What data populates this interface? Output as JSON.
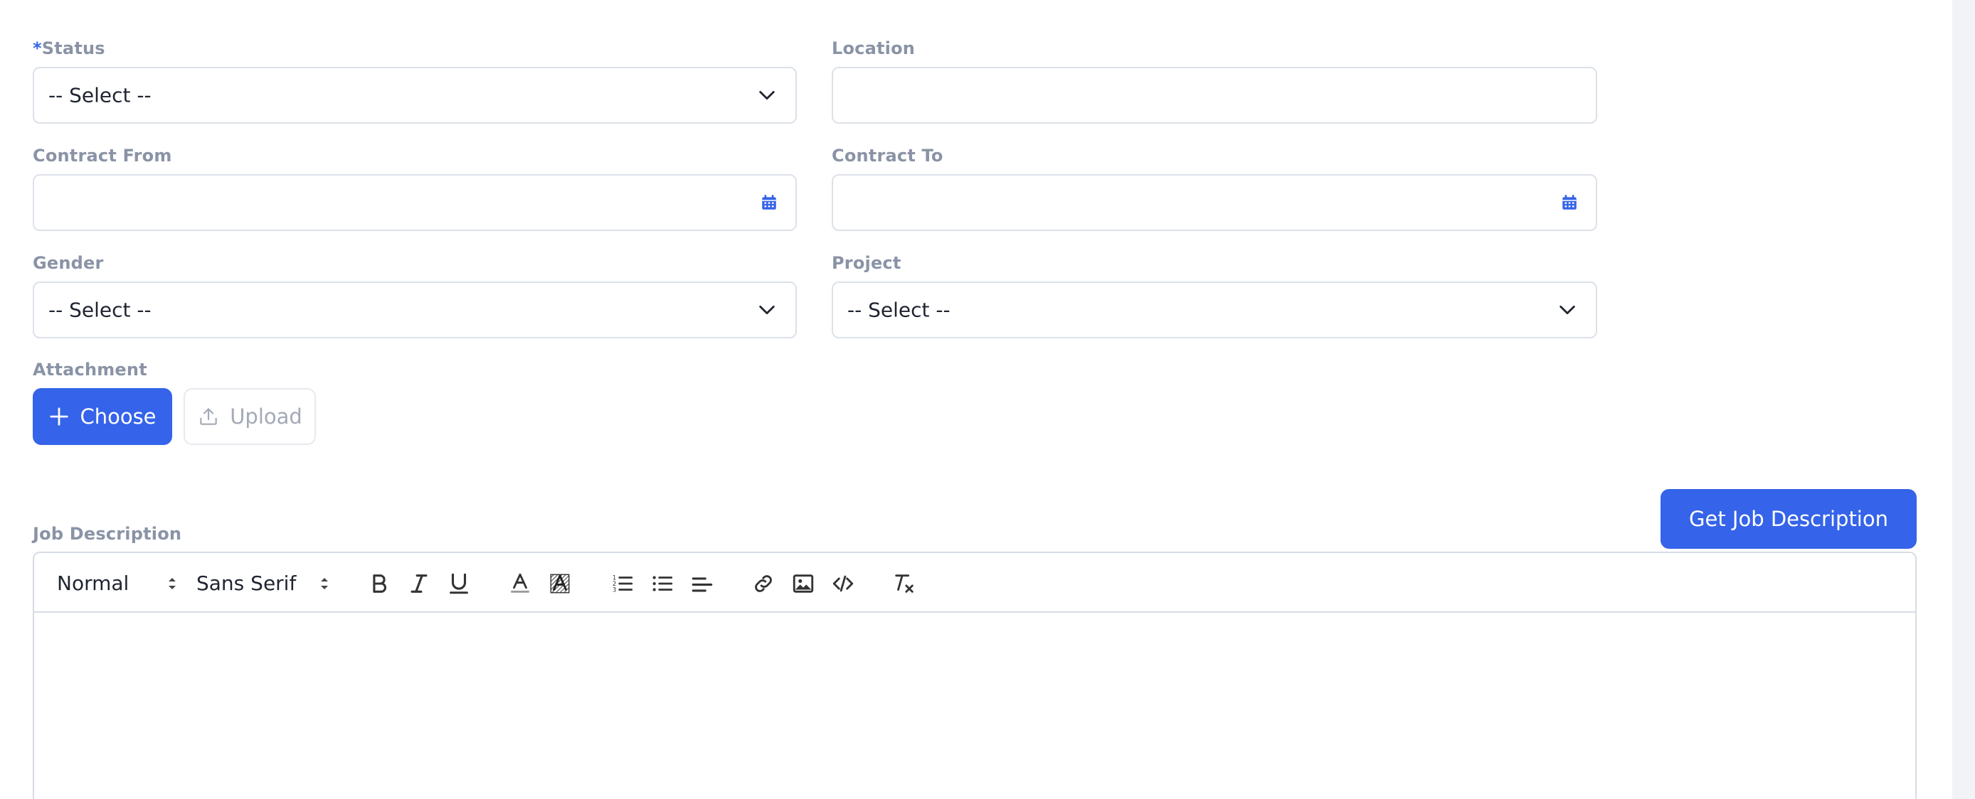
{
  "form": {
    "status": {
      "required_mark": "*",
      "label": "Status",
      "value": "-- Select --"
    },
    "location": {
      "label": "Location",
      "value": ""
    },
    "contract_from": {
      "label": "Contract From",
      "value": ""
    },
    "contract_to": {
      "label": "Contract To",
      "value": ""
    },
    "gender": {
      "label": "Gender",
      "value": "-- Select --"
    },
    "project": {
      "label": "Project",
      "value": "-- Select --"
    },
    "attachment": {
      "label": "Attachment",
      "choose_label": "Choose",
      "upload_label": "Upload"
    }
  },
  "job_description": {
    "label": "Job Description",
    "get_button_label": "Get Job Description",
    "toolbar": {
      "header_value": "Normal",
      "font_value": "Sans Serif",
      "icons": [
        "bold-icon",
        "italic-icon",
        "underline-icon",
        "text-color-icon",
        "background-color-icon",
        "ordered-list-icon",
        "bullet-list-icon",
        "align-icon",
        "link-icon",
        "image-icon",
        "code-icon",
        "clear-format-icon"
      ]
    },
    "content": ""
  },
  "colors": {
    "accent": "#3563e9",
    "label": "#8a93a6",
    "border": "#dde1e8"
  }
}
